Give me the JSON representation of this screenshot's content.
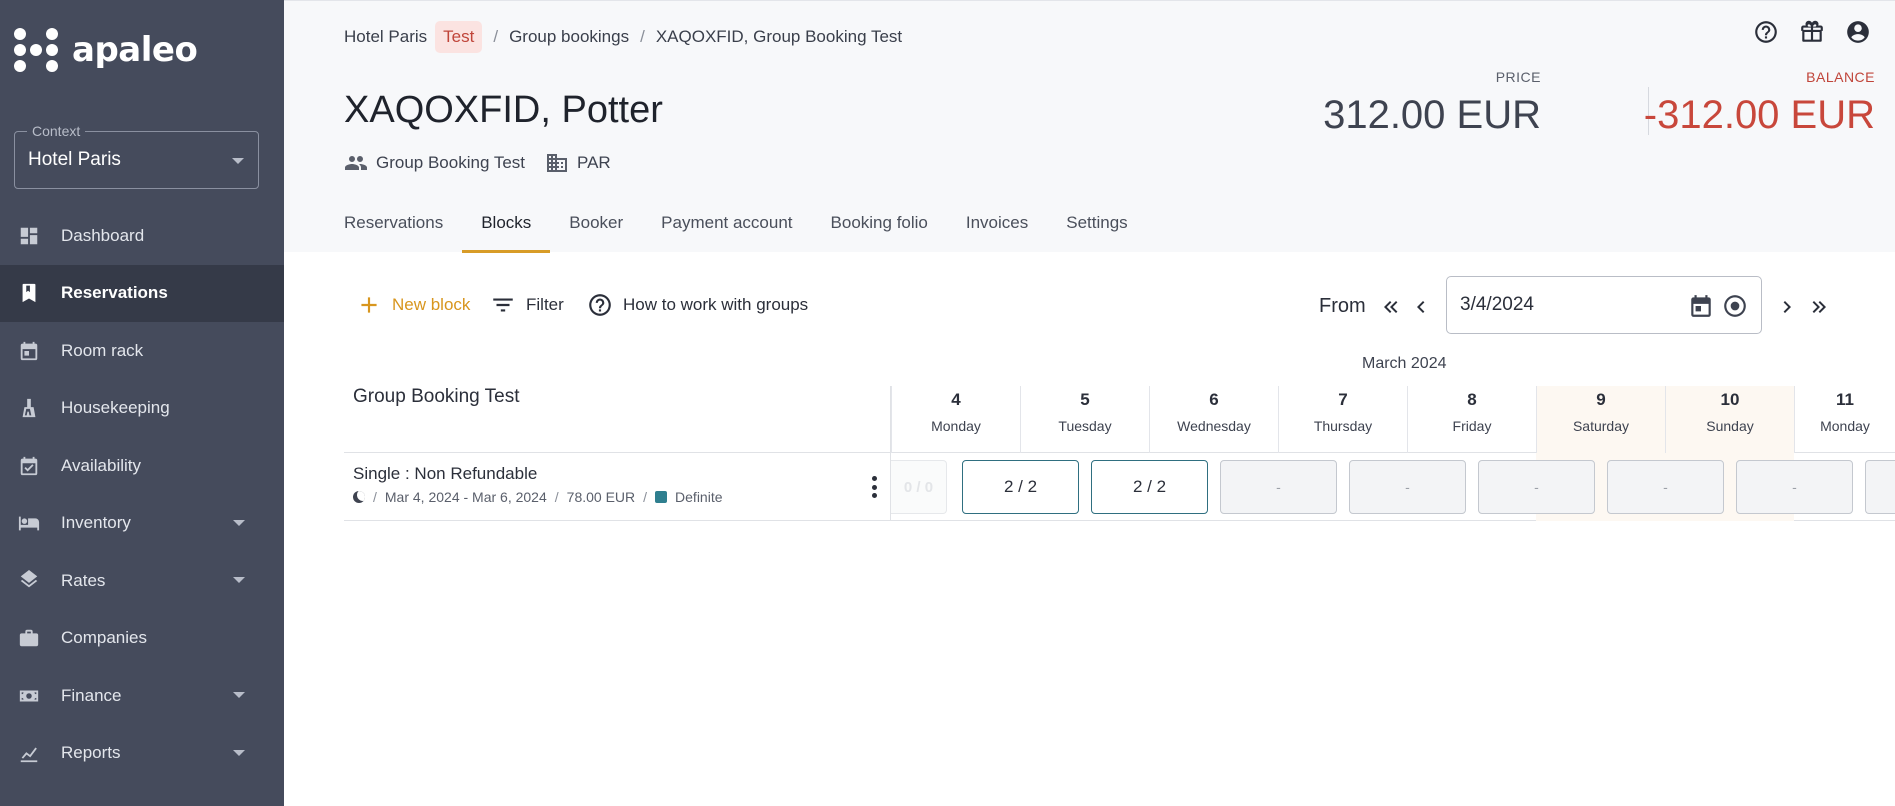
{
  "app": {
    "logo_text": "apaleo"
  },
  "sidebar": {
    "context_label": "Context",
    "context_value": "Hotel Paris",
    "items": [
      {
        "label": "Dashboard",
        "icon": "dashboard-icon"
      },
      {
        "label": "Reservations",
        "icon": "bookmark-icon",
        "active": true
      },
      {
        "label": "Room rack",
        "icon": "calendar-icon"
      },
      {
        "label": "Housekeeping",
        "icon": "broom-icon"
      },
      {
        "label": "Availability",
        "icon": "calendar-check-icon"
      },
      {
        "label": "Inventory",
        "icon": "bed-icon",
        "expandable": true
      },
      {
        "label": "Rates",
        "icon": "layers-icon",
        "expandable": true
      },
      {
        "label": "Companies",
        "icon": "briefcase-icon"
      },
      {
        "label": "Finance",
        "icon": "money-icon",
        "expandable": true
      },
      {
        "label": "Reports",
        "icon": "chart-icon",
        "expandable": true
      }
    ]
  },
  "header": {
    "breadcrumb": {
      "hotel": "Hotel Paris",
      "badge": "Test",
      "sep": "/",
      "group_bookings": "Group bookings",
      "current": "XAQOXFID, Group Booking Test"
    },
    "title": "XAQOXFID, Potter",
    "meta": {
      "group": "Group Booking Test",
      "property": "PAR"
    },
    "price_label": "PRICE",
    "price_value": "312.00 EUR",
    "balance_label": "BALANCE",
    "balance_value": "-312.00 EUR",
    "tabs": [
      {
        "label": "Reservations"
      },
      {
        "label": "Blocks",
        "active": true
      },
      {
        "label": "Booker"
      },
      {
        "label": "Payment account"
      },
      {
        "label": "Booking folio"
      },
      {
        "label": "Invoices"
      },
      {
        "label": "Settings"
      }
    ]
  },
  "toolbar": {
    "new_block": "New block",
    "filter": "Filter",
    "how_to": "How to work with groups",
    "from_label": "From",
    "date_value": "3/4/2024"
  },
  "grid": {
    "month": "March 2024",
    "group_title": "Group Booking Test",
    "days": [
      {
        "num": "4",
        "name": "Monday"
      },
      {
        "num": "5",
        "name": "Tuesday"
      },
      {
        "num": "6",
        "name": "Wednesday"
      },
      {
        "num": "7",
        "name": "Thursday"
      },
      {
        "num": "8",
        "name": "Friday"
      },
      {
        "num": "9",
        "name": "Saturday",
        "weekend": true
      },
      {
        "num": "10",
        "name": "Sunday",
        "weekend": true
      },
      {
        "num": "11",
        "name": "Monday"
      }
    ],
    "row": {
      "title": "Single : Non Refundable",
      "sep": "/",
      "dates": "Mar 4, 2024 - Mar 6, 2024",
      "price": "78.00 EUR",
      "status": "Definite",
      "status_color": "#2f7f8f",
      "faded_cell": "0 / 0",
      "cells": [
        "2 / 2",
        "2 / 2",
        "-",
        "-",
        "-",
        "-",
        "-"
      ]
    }
  },
  "colors": {
    "sidebar_bg": "#454b5c",
    "accent": "#d8961e",
    "balance_negative": "#c8473b",
    "booked_border": "#2f6f80"
  }
}
